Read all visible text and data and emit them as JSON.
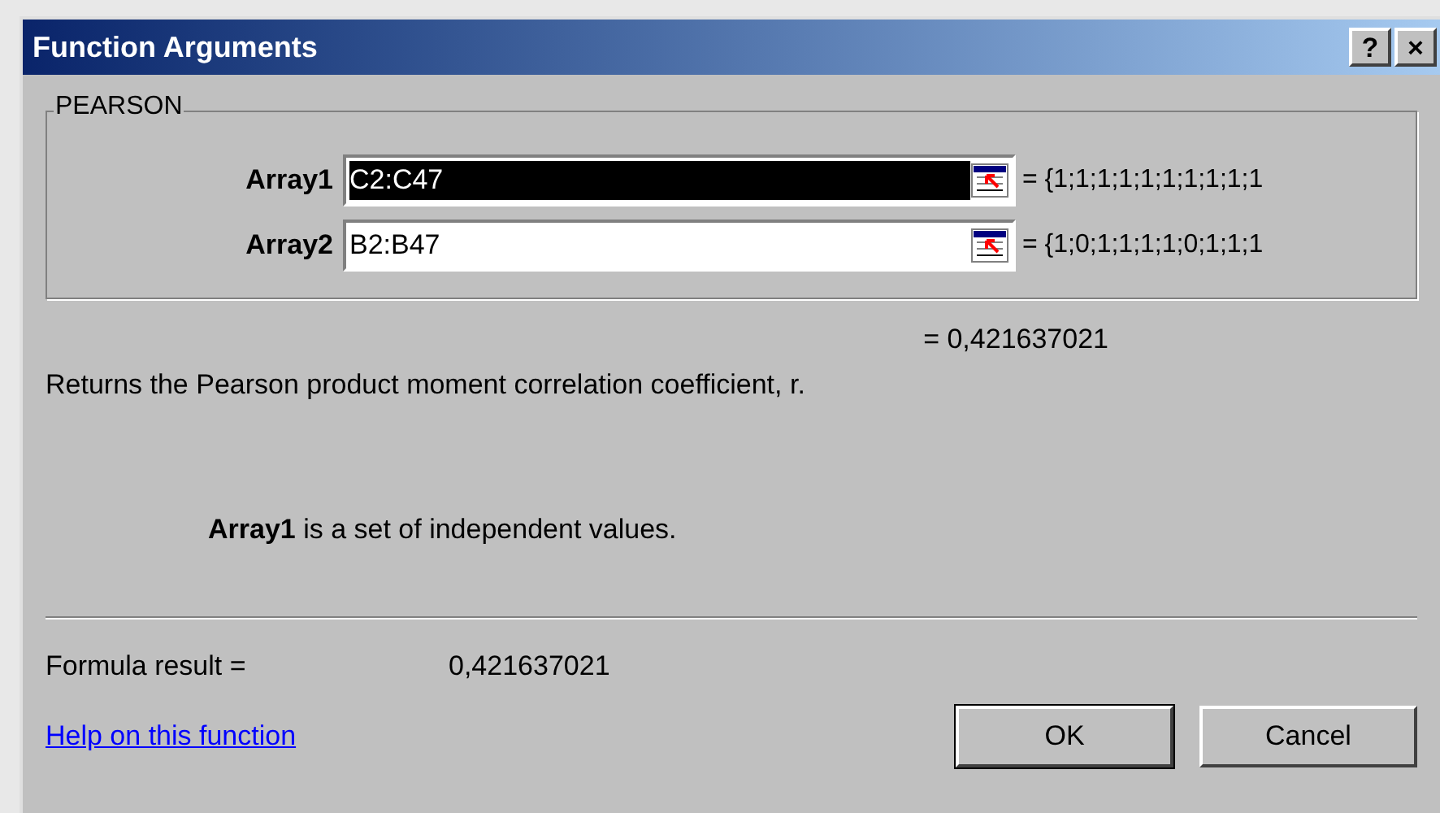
{
  "window": {
    "title": "Function Arguments",
    "title_buttons": [
      "?",
      "×"
    ]
  },
  "group": {
    "label": "PEARSON",
    "arguments": [
      {
        "label": "Array1",
        "value": "C2:C47",
        "selected": true,
        "result": "= {1;1;1;1;1;1;1;1;1;1"
      },
      {
        "label": "Array2",
        "value": "B2:B47",
        "selected": false,
        "result": "= {1;0;1;1;1;1;0;1;1;1"
      }
    ]
  },
  "function_result": "= 0,421637021",
  "description": "Returns the Pearson product moment correlation coefficient, r.",
  "argument_help": "**Array1** is a set of independent values.",
  "formula_result": {
    "label": "Formula result =",
    "value": "0,421637021"
  },
  "help_link": "Help on this function",
  "buttons": [
    {
      "label": "OK",
      "default": true
    },
    {
      "label": "Cancel",
      "default": false
    }
  ]
}
